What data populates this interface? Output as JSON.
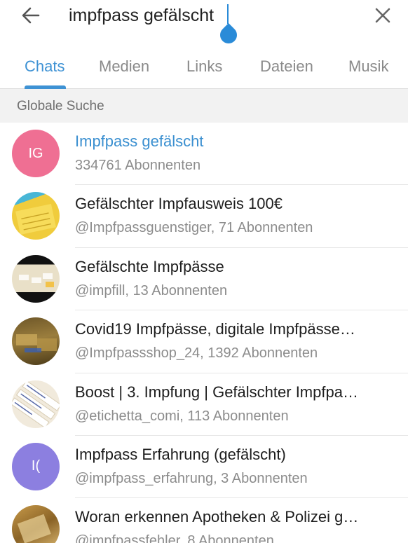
{
  "search": {
    "query": "impfpass gefälscht"
  },
  "tabs": [
    {
      "label": "Chats",
      "active": true
    },
    {
      "label": "Medien",
      "active": false
    },
    {
      "label": "Links",
      "active": false
    },
    {
      "label": "Dateien",
      "active": false
    },
    {
      "label": "Musik",
      "active": false
    }
  ],
  "section_header": "Globale Suche",
  "results": [
    {
      "title": "Impfpass gefälscht",
      "subtitle": "334761 Abonnenten",
      "avatar_initials": "IG",
      "avatar_color": "#ef6f93",
      "highlight": true
    },
    {
      "title": "Gefälschter Impfausweis 100€",
      "subtitle": "@Impfpassguenstiger, 71 Abonnenten",
      "avatar_initials": "",
      "avatar_color": "#e8c23a"
    },
    {
      "title": "Gefälschte Impfpässe",
      "subtitle": "@impfill, 13 Abonnenten",
      "avatar_initials": "",
      "avatar_color": "#c7b46a"
    },
    {
      "title": "Covid19 Impfpässe, digitale Impfpässe…",
      "subtitle": "@Impfpassshop_24, 1392 Abonnenten",
      "avatar_initials": "",
      "avatar_color": "#7a6431"
    },
    {
      "title": "Boost | 3. Impfung | Gefälschter Impfpa…",
      "subtitle": "@etichetta_comi, 113 Abonnenten",
      "avatar_initials": "",
      "avatar_color": "#efe6d6"
    },
    {
      "title": "Impfpass Erfahrung (gefälscht)",
      "subtitle": "@impfpass_erfahrung, 3 Abonnenten",
      "avatar_initials": "I(",
      "avatar_color": "#8c7fe0"
    },
    {
      "title": "Woran erkennen Apotheken & Polizei g…",
      "subtitle": "@impfpassfehler, 8 Abonnenten",
      "avatar_initials": "",
      "avatar_color": "#a17c3c"
    }
  ],
  "colors": {
    "accent": "#3e92d4",
    "caret": "#2a8bd8"
  },
  "icons": {
    "back": "arrow-left-icon",
    "clear": "close-icon"
  }
}
